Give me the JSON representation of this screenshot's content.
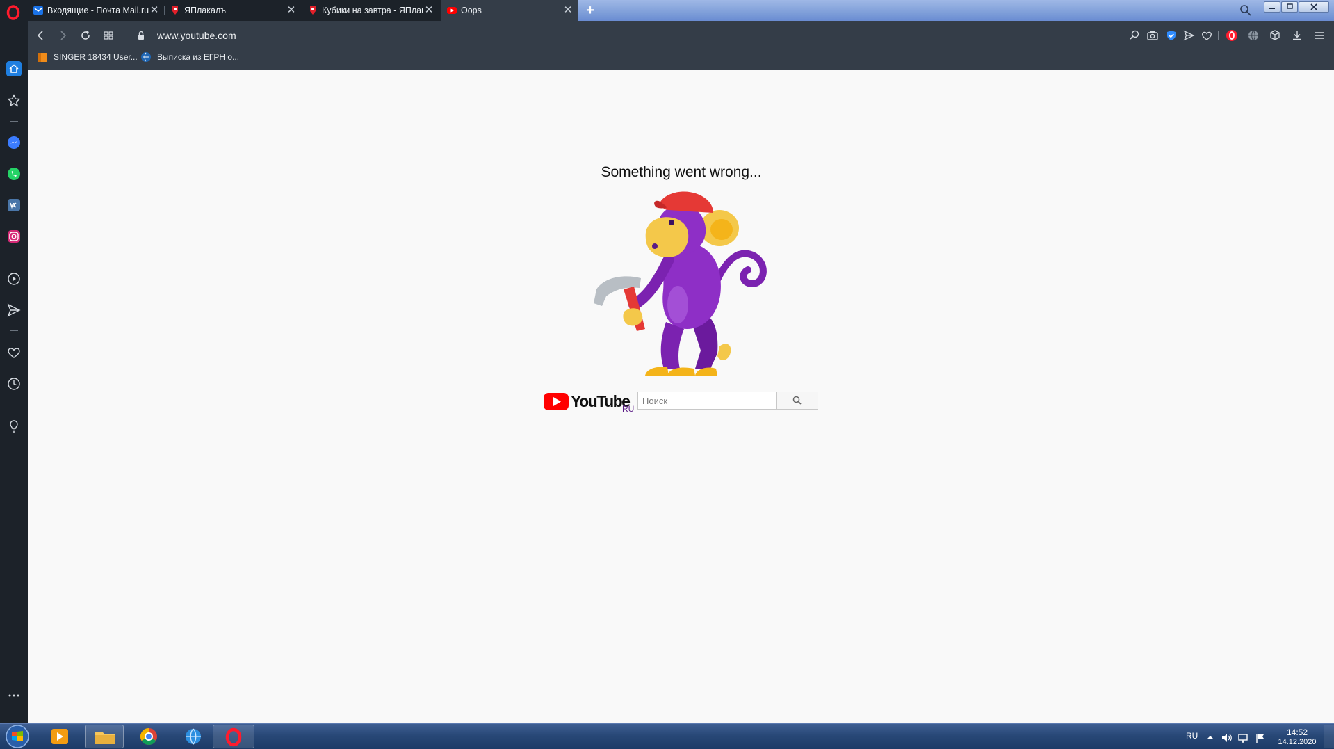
{
  "browser": {
    "tabs": [
      {
        "title": "Входящие - Почта Mail.ru",
        "favicon": "mail-icon",
        "active": false
      },
      {
        "title": "ЯПлакалъ",
        "favicon": "yaplakal-icon",
        "active": false
      },
      {
        "title": "Кубики на завтра - ЯПлакалъ",
        "favicon": "yaplakal-icon",
        "active": false
      },
      {
        "title": "Oops",
        "favicon": "youtube-icon",
        "active": true
      }
    ],
    "new_tab_label": "+",
    "close_label": "✕",
    "url": "www.youtube.com",
    "bookmarks": [
      {
        "label": "SINGER 18434 User...",
        "icon": "bookmark-box-icon"
      },
      {
        "label": "Выписка из ЕГРН о...",
        "icon": "globe-icon"
      }
    ],
    "accent_color": "#ff1b2d"
  },
  "page": {
    "error_message": "Something went wrong...",
    "logo_text": "YouTube",
    "logo_region": "RU",
    "search_placeholder": "Поиск"
  },
  "taskbar": {
    "language": "RU",
    "time": "14:52",
    "date": "14.12.2020"
  }
}
